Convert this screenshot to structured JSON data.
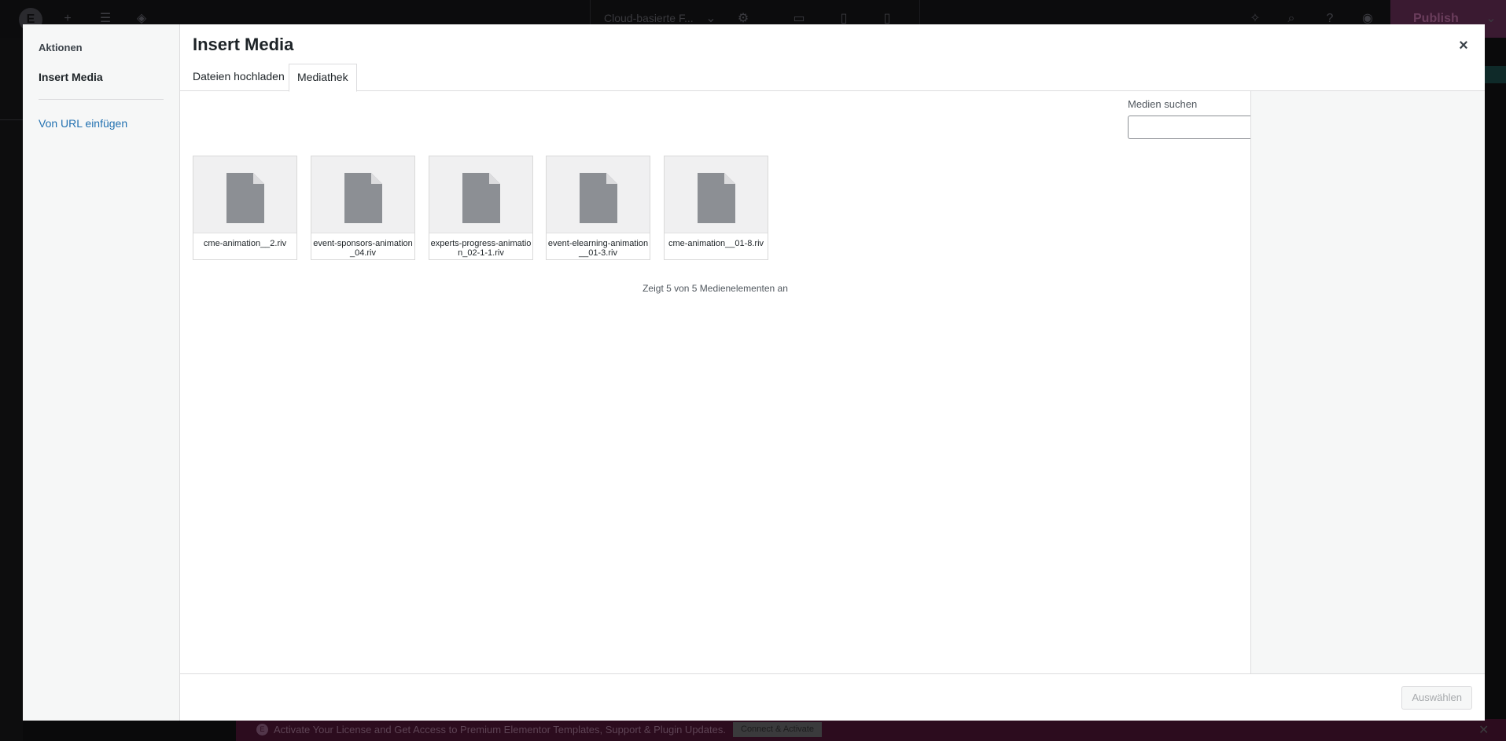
{
  "background": {
    "document_title": "Cloud-basierte F...",
    "publish_label": "Publish",
    "notice": {
      "text": "Activate Your License and Get Access to Premium Elementor Templates, Support & Plugin Updates.",
      "button": "Connect & Activate"
    }
  },
  "modal": {
    "menu": {
      "heading": "Aktionen",
      "active_item": "Insert Media",
      "url_link": "Von URL einfügen"
    },
    "title": "Insert Media",
    "close_symbol": "×",
    "tabs": [
      {
        "label": "Dateien hochladen",
        "active": false
      },
      {
        "label": "Mediathek",
        "active": true
      }
    ],
    "search": {
      "label": "Medien suchen",
      "value": ""
    },
    "files": [
      {
        "name": "cme-animation__2.riv",
        "icon": "document-icon"
      },
      {
        "name": "event-sponsors-animation_04.riv",
        "icon": "document-icon"
      },
      {
        "name": "experts-progress-animation_02-1-1.riv",
        "icon": "document-icon"
      },
      {
        "name": "event-elearning-animation__01-3.riv",
        "icon": "document-icon"
      },
      {
        "name": "cme-animation__01-8.riv",
        "icon": "document-icon"
      }
    ],
    "count_text": "Zeigt 5 von 5 Medienelementen an",
    "select_button": "Auswählen"
  }
}
